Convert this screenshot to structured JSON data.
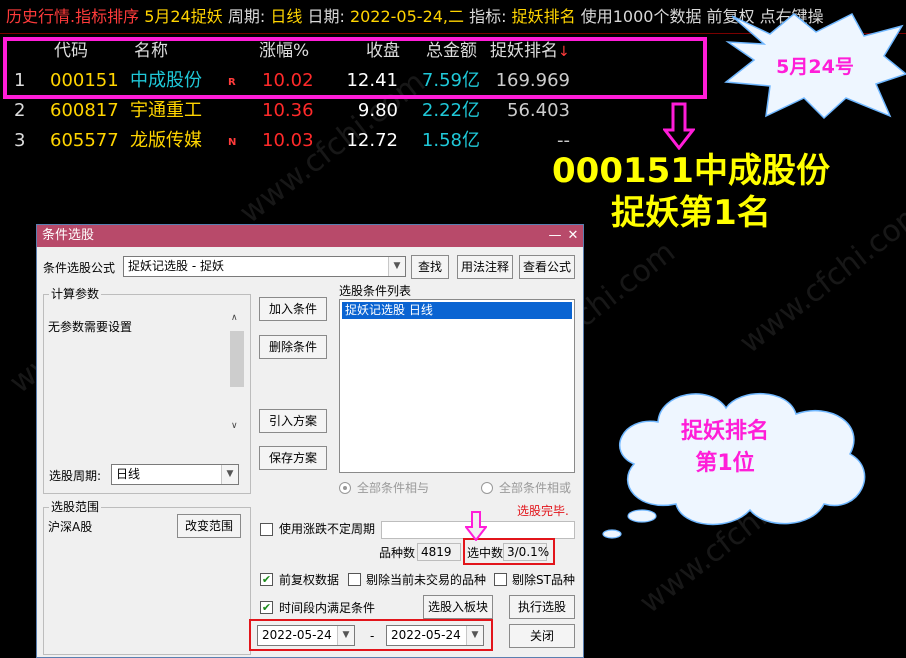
{
  "terminal": {
    "title_parts": {
      "module": "历史行情.指标排序",
      "date_tag": "5月24捉妖",
      "period_label": "周期:",
      "period_value": "日线",
      "date_label": "日期:",
      "date_value": "2022-05-24,二",
      "indicator_label": "指标:",
      "indicator_value": "捉妖排名",
      "note": "使用1000个数据 前复权 点右键操"
    },
    "columns": {
      "code": "代码",
      "name": "名称",
      "change": "涨幅%",
      "close": "收盘",
      "amount": "总金额",
      "rank": "捉妖排名",
      "sort_indicator": "↓"
    },
    "rows": [
      {
        "index": "1",
        "code": "000151",
        "name": "中成股份",
        "flag": "R",
        "change": "10.02",
        "close": "12.41",
        "amount": "7.59亿",
        "rank": "169.969"
      },
      {
        "index": "2",
        "code": "600817",
        "name": "宇通重工",
        "flag": "",
        "change": "10.36",
        "close": "9.80",
        "amount": "2.22亿",
        "rank": "56.403"
      },
      {
        "index": "3",
        "code": "605577",
        "name": "龙版传媒",
        "flag": "N",
        "change": "10.03",
        "close": "12.72",
        "amount": "1.58亿",
        "rank": "--"
      }
    ]
  },
  "annotations": {
    "burst_label": "5月24号",
    "callout_line1": "000151中成股份",
    "callout_line2": "捉妖第1名",
    "cloud_line1": "捉妖排名",
    "cloud_line2": "第1位",
    "highlight_color": "#ff1dd8",
    "callout_color": "#ffff00"
  },
  "watermark": "www.cfchi.com",
  "dialog": {
    "title": "条件选股",
    "minimize": "—",
    "close": "✕",
    "formula_label": "条件选股公式",
    "formula_value": "捉妖记选股  - 捉妖",
    "find_button": "查找",
    "usage_button": "用法注释",
    "view_formula_button": "查看公式",
    "params_group": "计算参数",
    "params_text": "无参数需要设置",
    "period_label": "选股周期:",
    "period_value": "日线",
    "add_condition": "加入条件",
    "delete_condition": "删除条件",
    "import_scheme": "引入方案",
    "save_scheme": "保存方案",
    "condition_list_label": "选股条件列表",
    "condition_list": [
      "捉妖记选股  日线"
    ],
    "radio_and": "全部条件相与",
    "radio_or": "全部条件相或",
    "status_text": "选股完毕.",
    "range_group": "选股范围",
    "range_value": "沪深A股",
    "change_range": "改变范围",
    "use_variable_period": "使用涨跌不定周期",
    "variety_count_label": "品种数",
    "variety_count": "4819",
    "selected_count_label": "选中数",
    "selected_count": "3/0.1%",
    "adjusted_data": "前复权数据",
    "exclude_untraded": "剔除当前未交易的品种",
    "exclude_st": "剔除ST品种",
    "time_range_condition": "时间段内满足条件",
    "select_to_block": "选股入板块",
    "execute": "执行选股",
    "date_from": "2022-05-24",
    "date_to": "2022-05-24",
    "date_sep": "-",
    "close_button": "关闭",
    "checks": {
      "use_variable_period": false,
      "adjusted_data": true,
      "exclude_untraded": false,
      "exclude_st": false,
      "time_range_condition": true
    }
  }
}
